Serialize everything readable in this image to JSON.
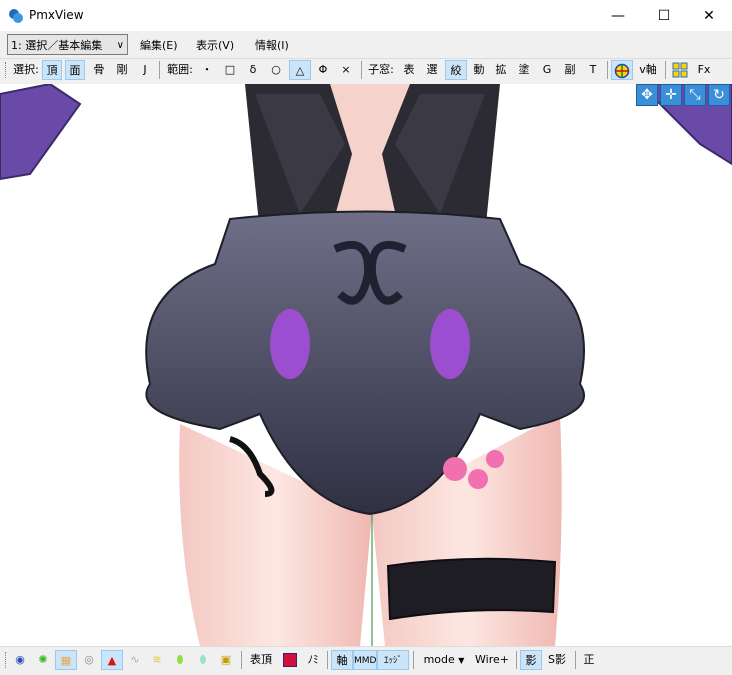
{
  "window": {
    "title": "PmxView",
    "minimize": "—",
    "maximize": "☐",
    "close": "✕"
  },
  "menubar": {
    "mode_select": "1: 選択／基本編集",
    "menus": [
      "編集(E)",
      "表示(V)",
      "情報(I)"
    ]
  },
  "toolbar": {
    "select_label": "選択:",
    "select_items": [
      "頂",
      "面",
      "骨",
      "剛",
      "J"
    ],
    "range_label": "範囲:",
    "range_items": [
      "・",
      "□",
      "δ",
      "○",
      "△",
      "Φ",
      "×"
    ],
    "child_label": "子窓:",
    "child_items": [
      "表",
      "選",
      "絞",
      "動",
      "拡",
      "塗",
      "G",
      "副",
      "T"
    ],
    "axis_label": "v軸",
    "fx_label": "Fx"
  },
  "bottombar": {
    "labels": [
      "表頂",
      "ﾉﾐ",
      "軸",
      "MMD",
      "ｴｯｼﾞ",
      "mode",
      "Wire+",
      "影",
      "S影",
      "正"
    ]
  },
  "colors": {
    "chrome": "#f0f0f0",
    "active": "#cce4f7",
    "active_border": "#99c9ef",
    "accent": "#3b8fd8"
  }
}
